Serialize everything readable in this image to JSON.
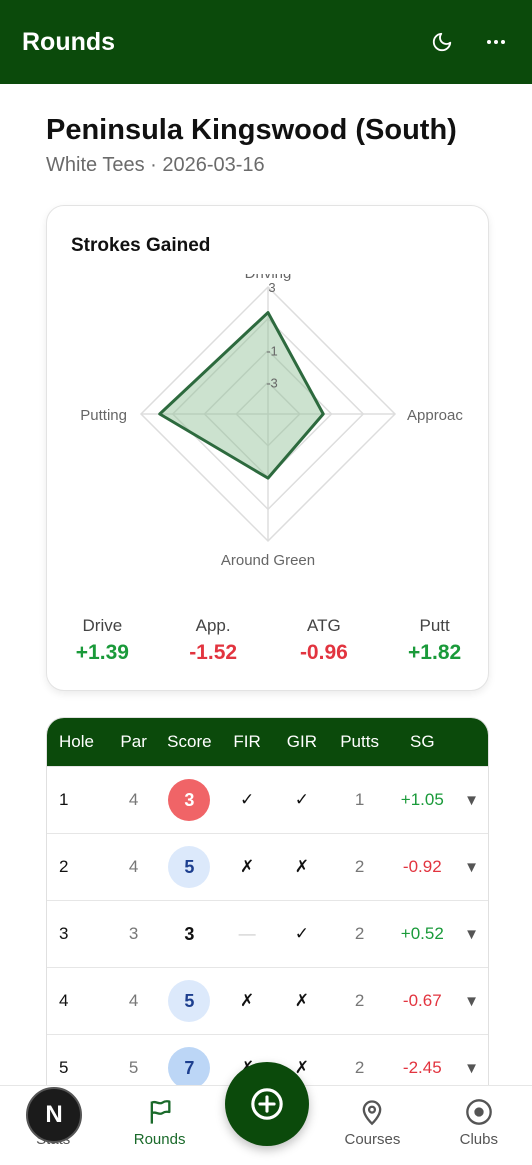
{
  "header": {
    "title": "Rounds",
    "theme_icon": "moon-icon",
    "menu_icon": "more-horizontal-icon"
  },
  "round": {
    "course": "Peninsula Kingswood (South)",
    "subtitle": "White Tees · 2026-03-16"
  },
  "strokes_gained": {
    "title": "Strokes Gained",
    "axes": [
      "Driving",
      "Approac",
      "Around Green",
      "Putting"
    ],
    "ring_labels": [
      "3",
      "-1",
      "-3"
    ],
    "summary": [
      {
        "label": "Drive",
        "value": "+1.39",
        "tone": "pos"
      },
      {
        "label": "App.",
        "value": "-1.52",
        "tone": "neg"
      },
      {
        "label": "ATG",
        "value": "-0.96",
        "tone": "neg"
      },
      {
        "label": "Putt",
        "value": "+1.82",
        "tone": "pos"
      }
    ]
  },
  "chart_data": {
    "type": "radar",
    "axes": [
      "Driving",
      "Approach",
      "Around Green",
      "Putting"
    ],
    "values": [
      1.39,
      -1.52,
      -0.96,
      1.82
    ],
    "rlim": [
      -5,
      3
    ],
    "ring_labels": [
      3,
      -1,
      -3
    ],
    "colors": {
      "line": "#2d6a3e",
      "fill": "#8fbf95"
    }
  },
  "table": {
    "headers": [
      "Hole",
      "Par",
      "Score",
      "FIR",
      "GIR",
      "Putts",
      "SG"
    ],
    "rows": [
      {
        "hole": "1",
        "par": "4",
        "score": "3",
        "score_style": "birdie",
        "fir": "✓",
        "gir": "✓",
        "putts": "1",
        "sg": "+1.05",
        "tone": "pos"
      },
      {
        "hole": "2",
        "par": "4",
        "score": "5",
        "score_style": "bogey",
        "fir": "✗",
        "gir": "✗",
        "putts": "2",
        "sg": "-0.92",
        "tone": "neg"
      },
      {
        "hole": "3",
        "par": "3",
        "score": "3",
        "score_style": "par",
        "fir": "—",
        "gir": "✓",
        "putts": "2",
        "sg": "+0.52",
        "tone": "pos"
      },
      {
        "hole": "4",
        "par": "4",
        "score": "5",
        "score_style": "bogey",
        "fir": "✗",
        "gir": "✗",
        "putts": "2",
        "sg": "-0.67",
        "tone": "neg"
      },
      {
        "hole": "5",
        "par": "5",
        "score": "7",
        "score_style": "double",
        "fir": "✗",
        "gir": "✗",
        "putts": "2",
        "sg": "-2.45",
        "tone": "neg"
      }
    ],
    "expand_icon": "▼"
  },
  "colors": {
    "primary": "#0b4a0b",
    "positive": "#1a9a3a",
    "negative": "#e2343f",
    "birdie": "#f06467",
    "bogey": "#dce9fb",
    "double": "#bcd6f6"
  },
  "nav": {
    "items": [
      {
        "label": "Stats",
        "icon": "stats-icon"
      },
      {
        "label": "Rounds",
        "icon": "flag-icon",
        "active": true
      },
      {
        "label": "",
        "icon": "add-icon"
      },
      {
        "label": "Courses",
        "icon": "map-pin-icon"
      },
      {
        "label": "Clubs",
        "icon": "target-icon"
      }
    ],
    "dev_badge": "N"
  }
}
